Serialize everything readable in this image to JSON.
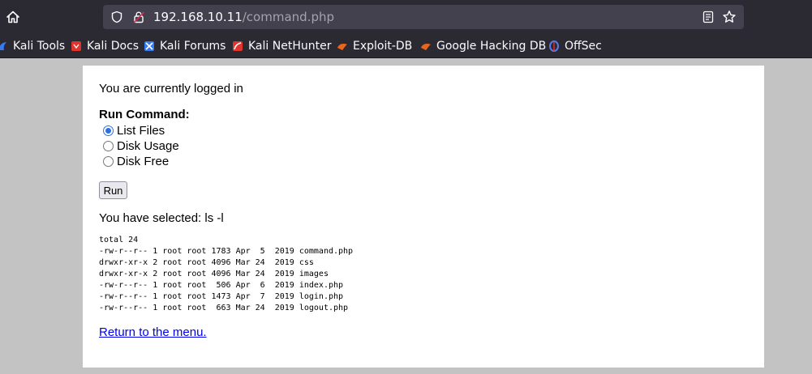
{
  "browser": {
    "url_host": "192.168.10.11",
    "url_path": "/command.php",
    "bookmarks": [
      {
        "label": "Kali Tools",
        "icon": "kali-dragon-icon",
        "color": "#367bf0"
      },
      {
        "label": "Kali Docs",
        "icon": "kali-docs-icon",
        "color": "#e0342c"
      },
      {
        "label": "Kali Forums",
        "icon": "kali-forums-icon",
        "color": "#367bf0"
      },
      {
        "label": "Kali NetHunter",
        "icon": "kali-nethunter-icon",
        "color": "#e0342c"
      },
      {
        "label": "Exploit-DB",
        "icon": "exploit-db-icon",
        "color": "#e8661c"
      },
      {
        "label": "Google Hacking DB",
        "icon": "ghdb-icon",
        "color": "#e8661c"
      },
      {
        "label": "OffSec",
        "icon": "offsec-icon",
        "color": "#5b7be8"
      }
    ]
  },
  "page": {
    "status": "You are currently logged in",
    "run_label": "Run Command:",
    "options": [
      {
        "label": "List Files",
        "checked": true
      },
      {
        "label": "Disk Usage",
        "checked": false
      },
      {
        "label": "Disk Free",
        "checked": false
      }
    ],
    "run_button": "Run",
    "selected_text": "You have selected: ls -l",
    "output": "total 24\n-rw-r--r-- 1 root root 1783 Apr  5  2019 command.php\ndrwxr-xr-x 2 root root 4096 Mar 24  2019 css\ndrwxr-xr-x 2 root root 4096 Mar 24  2019 images\n-rw-r--r-- 1 root root  506 Apr  6  2019 index.php\n-rw-r--r-- 1 root root 1473 Apr  7  2019 login.php\n-rw-r--r-- 1 root root  663 Mar 24  2019 logout.php",
    "back_link": "Return to the menu."
  }
}
